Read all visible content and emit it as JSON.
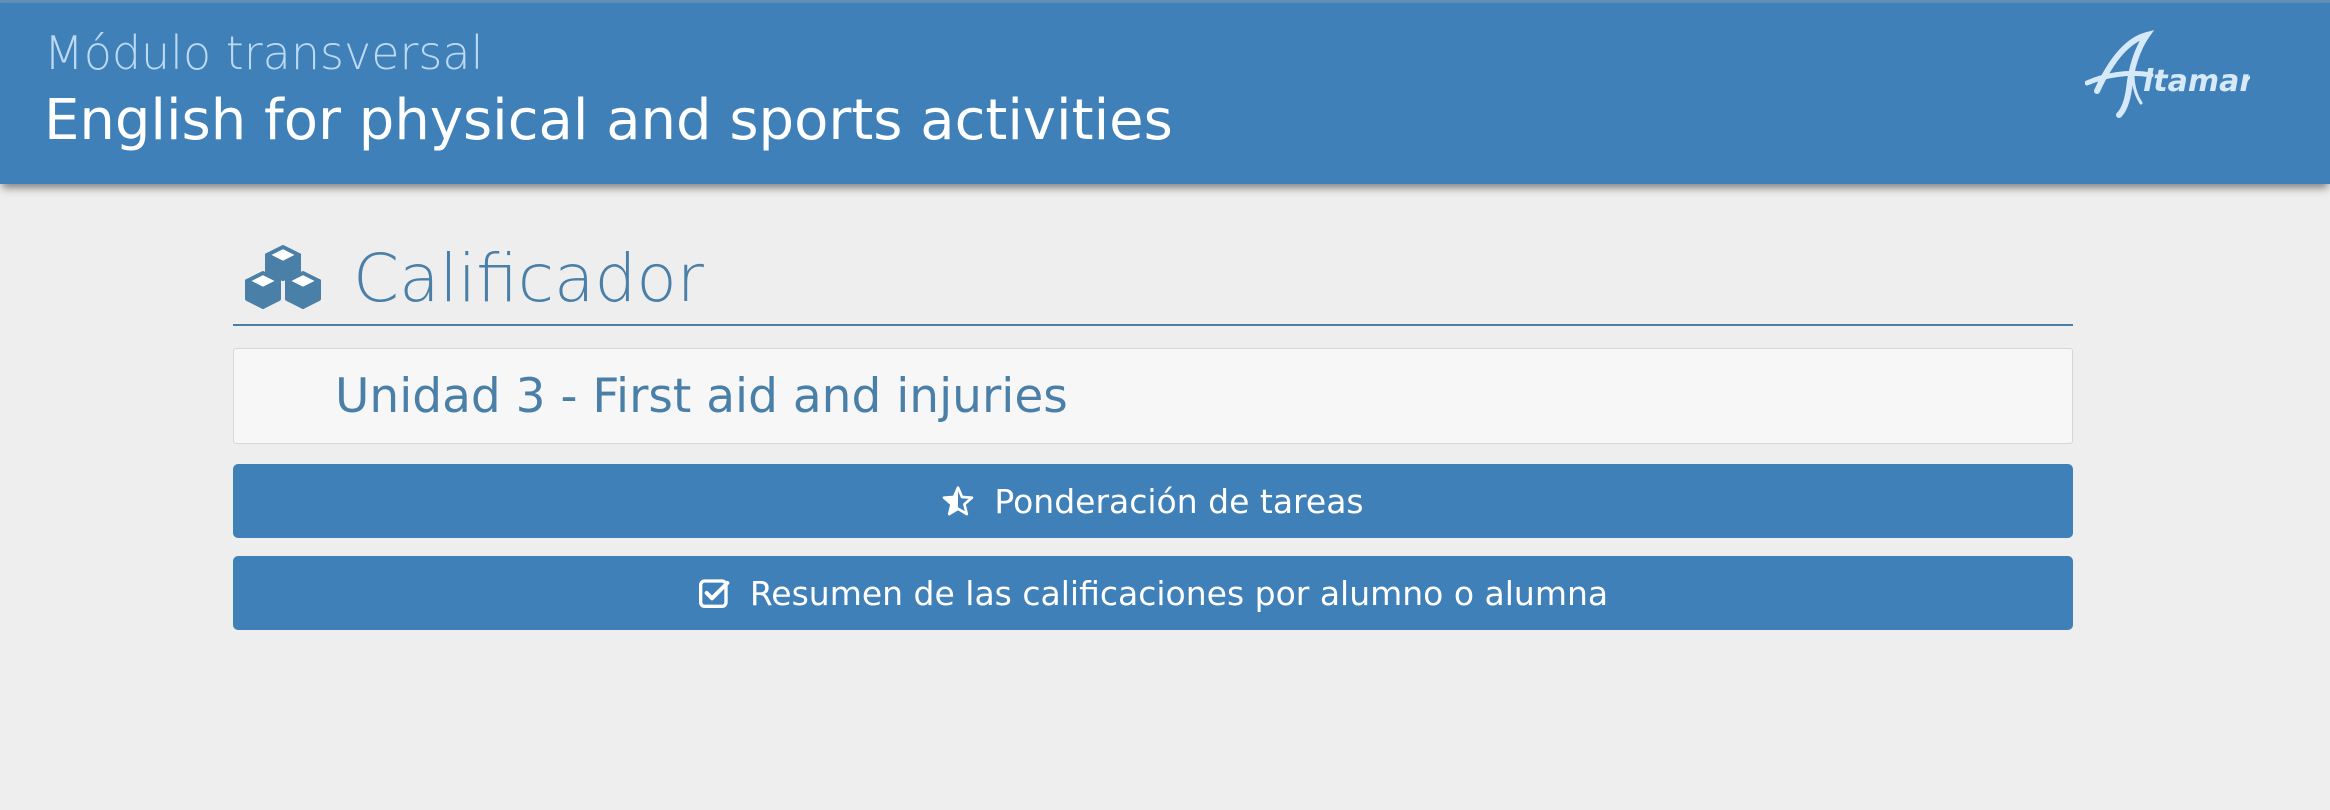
{
  "header": {
    "subtitle": "Módulo transversal",
    "title": "English for physical and sports activities",
    "logo_icon": "altamar-logo"
  },
  "section": {
    "icon": "cubes-icon",
    "title": "Calificador"
  },
  "unit": {
    "title": "Unidad 3 - First aid and injuries"
  },
  "buttons": [
    {
      "icon": "star-half-icon",
      "label": "Ponderación de tareas"
    },
    {
      "icon": "check-square-icon",
      "label": "Resumen de las calificaciones por alumno o alumna"
    }
  ],
  "colors": {
    "header_bg": "#4080b8",
    "accent": "#4a7fa8",
    "button_bg": "#4080b8",
    "page_bg": "#eeeeee"
  }
}
